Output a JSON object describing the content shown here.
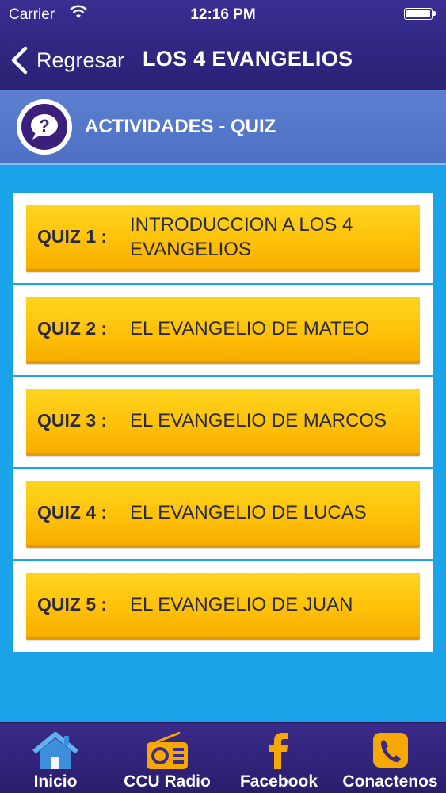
{
  "status_bar": {
    "carrier": "Carrier",
    "time": "12:16 PM"
  },
  "nav": {
    "back_label": "Regresar",
    "title": "LOS 4 EVANGELIOS"
  },
  "section": {
    "title": "ACTIVIDADES - QUIZ",
    "icon": "question-speech-icon"
  },
  "quizzes": [
    {
      "number": "QUIZ 1 :",
      "title": "INTRODUCCION A LOS 4 EVANGELIOS"
    },
    {
      "number": "QUIZ 2 :",
      "title": "EL EVANGELIO  DE MATEO"
    },
    {
      "number": "QUIZ 3 :",
      "title": "EL EVANGELIO  DE MARCOS"
    },
    {
      "number": "QUIZ 4 :",
      "title": "EL EVANGELIO  DE LUCAS"
    },
    {
      "number": "QUIZ 5 :",
      "title": "EL EVANGELIO  DE JUAN"
    }
  ],
  "tabbar": {
    "items": [
      {
        "label": "Inicio",
        "icon": "home-icon"
      },
      {
        "label": "CCU Radio",
        "icon": "radio-icon"
      },
      {
        "label": "Facebook",
        "icon": "facebook-icon"
      },
      {
        "label": "Conactenos",
        "icon": "phone-icon"
      }
    ]
  },
  "colors": {
    "background": "#1aa3e8",
    "header": "#2f2680",
    "section_bar": "#5577c8",
    "quiz_button": "#ffc10a",
    "tabbar": "#2a1d6b"
  }
}
